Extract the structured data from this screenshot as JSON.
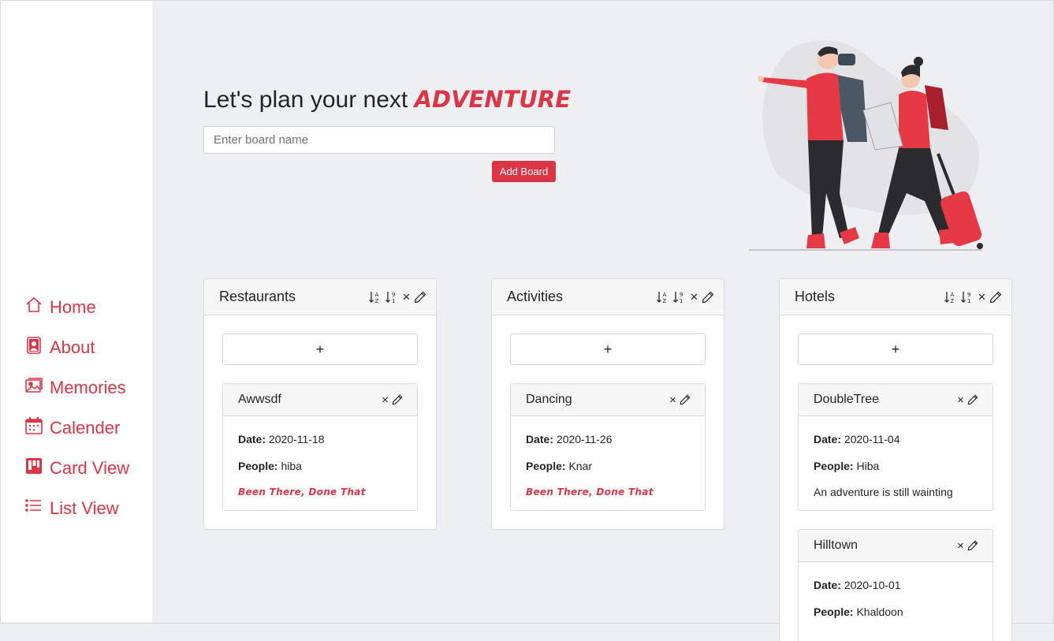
{
  "nav": {
    "items": [
      {
        "label": "Home",
        "icon": "home-icon"
      },
      {
        "label": "About",
        "icon": "person-badge-icon"
      },
      {
        "label": "Memories",
        "icon": "images-icon"
      },
      {
        "label": "Calender",
        "icon": "calendar-icon"
      },
      {
        "label": "Card View",
        "icon": "kanban-icon"
      },
      {
        "label": "List View",
        "icon": "list-icon"
      }
    ]
  },
  "hero": {
    "title": "Let's plan your next",
    "accent": "ADVENTURE",
    "input_placeholder": "Enter board name",
    "add_button": "Add Board"
  },
  "colors": {
    "accent": "#dc3545",
    "background": "#eeeff3"
  },
  "columns": [
    {
      "title": "Restaurants",
      "add_label": "+",
      "cards": [
        {
          "title": "Awwsdf",
          "date_label": "Date:",
          "date": "2020-11-18",
          "people_label": "People:",
          "people": "hiba",
          "status": "Been There, Done That",
          "done": true
        }
      ]
    },
    {
      "title": "Activities",
      "add_label": "+",
      "cards": [
        {
          "title": "Dancing",
          "date_label": "Date:",
          "date": "2020-11-26",
          "people_label": "People:",
          "people": "Knar",
          "status": "Been There, Done That",
          "done": true
        }
      ]
    },
    {
      "title": "Hotels",
      "add_label": "+",
      "cards": [
        {
          "title": "DoubleTree",
          "date_label": "Date:",
          "date": "2020-11-04",
          "people_label": "People:",
          "people": "Hiba",
          "status": "An adventure is still wainting",
          "done": false
        },
        {
          "title": "Hilltown",
          "date_label": "Date:",
          "date": "2020-10-01",
          "people_label": "People:",
          "people": "Khaldoon",
          "status": "",
          "done": false
        }
      ]
    }
  ],
  "tools": {
    "close": "×"
  }
}
